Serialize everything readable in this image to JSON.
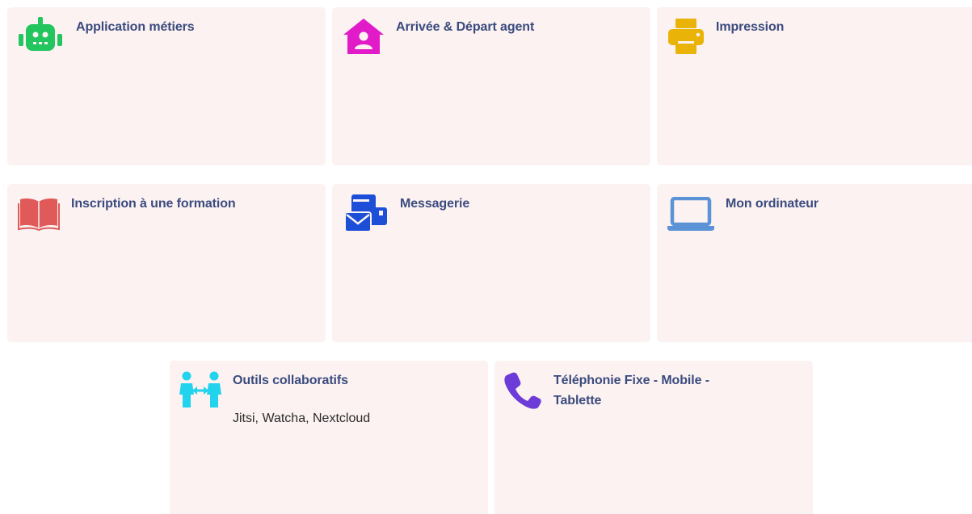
{
  "tiles": [
    {
      "title": "Application métiers",
      "icon": "robot-icon",
      "color": "#22c55e"
    },
    {
      "title": "Arrivée & Départ agent",
      "icon": "house-user-icon",
      "color": "#e21bc9"
    },
    {
      "title": "Impression",
      "icon": "printer-icon",
      "color": "#eab308"
    },
    {
      "title": "Inscription à une formation",
      "icon": "open-book-icon",
      "color": "#e05a5a"
    },
    {
      "title": "Messagerie",
      "icon": "envelope-icon",
      "color": "#1d4ed8"
    },
    {
      "title": "Mon ordinateur",
      "icon": "laptop-icon",
      "color": "#5b93d6"
    },
    {
      "title": "Outils collaboratifs",
      "description": "Jitsi, Watcha, Nextcloud",
      "icon": "people-arrows-icon",
      "color": "#22d3ee"
    },
    {
      "title_line1": "Téléphonie Fixe - Mobile -",
      "title_line2": "Tablette",
      "icon": "phone-icon",
      "color": "#6d3bd8"
    }
  ],
  "colors": {
    "tile_background": "#fbf2f1",
    "title_text": "#3b4b7f",
    "description_text": "#2b2b2b"
  }
}
